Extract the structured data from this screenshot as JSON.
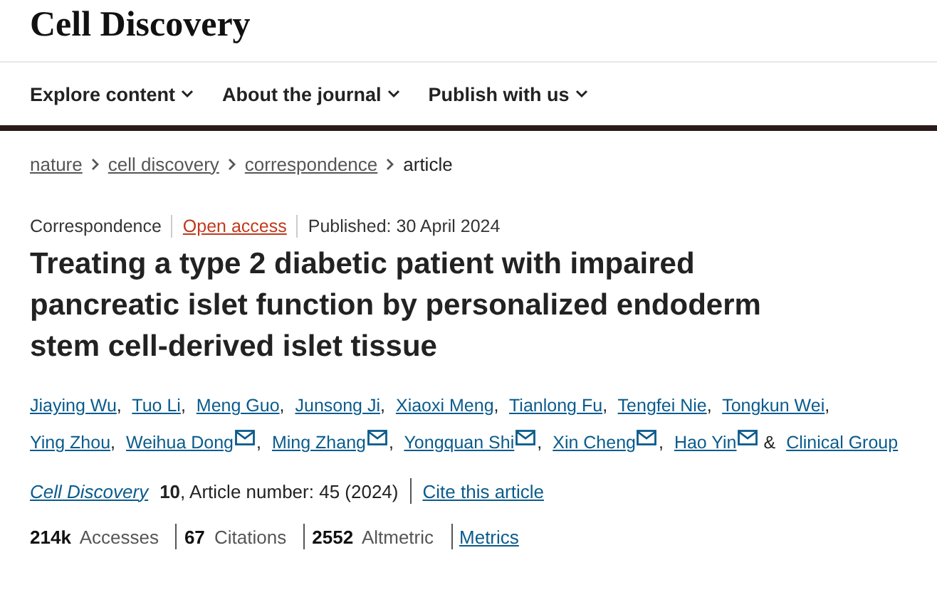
{
  "site": {
    "logo": "Cell Discovery"
  },
  "nav": [
    {
      "label": "Explore content"
    },
    {
      "label": "About the journal"
    },
    {
      "label": "Publish with us"
    }
  ],
  "breadcrumbs": [
    {
      "label": "nature",
      "link": true
    },
    {
      "label": "cell discovery",
      "link": true
    },
    {
      "label": "correspondence",
      "link": true
    },
    {
      "label": "article",
      "link": false
    }
  ],
  "meta": [
    {
      "text": "Correspondence",
      "kind": "plain"
    },
    {
      "text": "Open access",
      "kind": "link"
    },
    {
      "text": "Published: 30 April 2024",
      "kind": "plain"
    }
  ],
  "title": "Treating a type 2 diabetic patient with impaired pancreatic islet function by personalized endoderm stem cell-derived islet tissue",
  "authors": [
    {
      "name": "Jiaying Wu",
      "mail": false,
      "after": ","
    },
    {
      "name": "Tuo Li",
      "mail": false,
      "after": ","
    },
    {
      "name": "Meng Guo",
      "mail": false,
      "after": ","
    },
    {
      "name": "Junsong Ji",
      "mail": false,
      "after": ","
    },
    {
      "name": "Xiaoxi Meng",
      "mail": false,
      "after": ","
    },
    {
      "name": "Tianlong Fu",
      "mail": false,
      "after": ","
    },
    {
      "name": "Tengfei Nie",
      "mail": false,
      "after": ","
    },
    {
      "name": "Tongkun Wei",
      "mail": false,
      "after": ","
    },
    {
      "name": "Ying Zhou",
      "mail": false,
      "after": ","
    },
    {
      "name": "Weihua Dong",
      "mail": true,
      "after": ","
    },
    {
      "name": "Ming Zhang",
      "mail": true,
      "after": ","
    },
    {
      "name": "Yongquan Shi",
      "mail": true,
      "after": ","
    },
    {
      "name": "Xin Cheng",
      "mail": true,
      "after": ","
    },
    {
      "name": "Hao Yin",
      "mail": true,
      "after": "&"
    },
    {
      "name": "Clinical Group",
      "mail": false
    }
  ],
  "citation": {
    "journal": "Cell Discovery",
    "details": "**10**, Article number: 45 (2024)",
    "cite_link": "Cite this article"
  },
  "metrics": [
    "**214k** Accesses",
    "**67** Citations",
    "**2552** Altmetric"
  ],
  "metrics_link": "Metrics"
}
